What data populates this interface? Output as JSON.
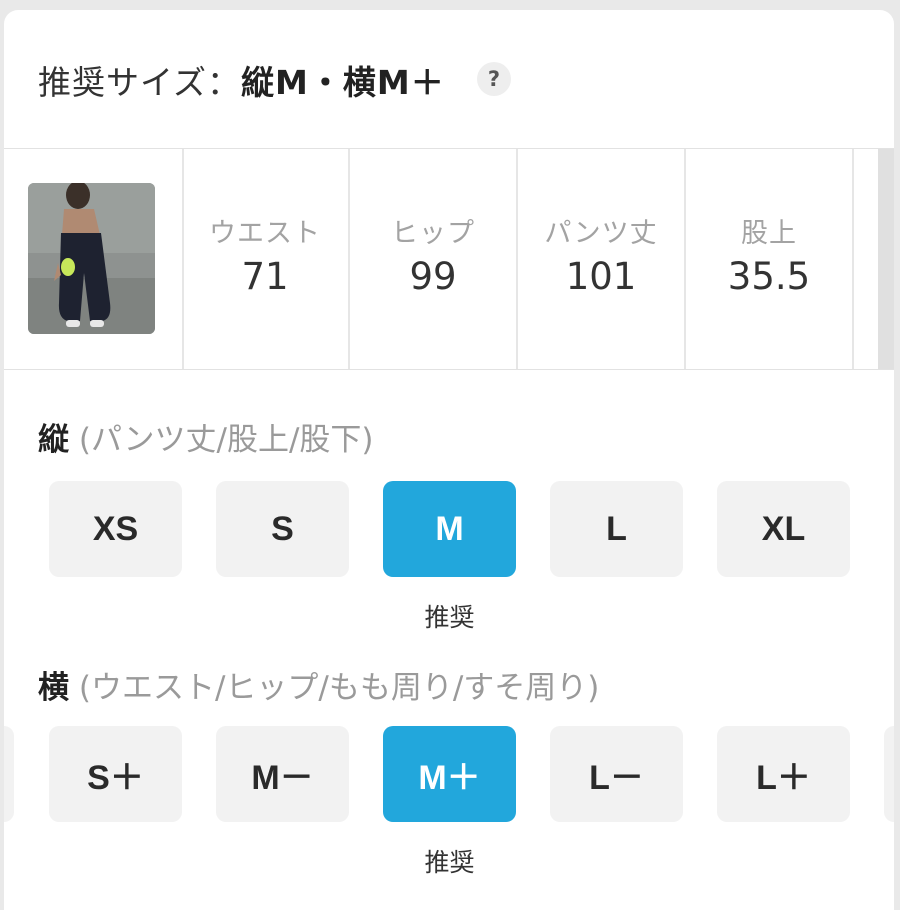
{
  "header": {
    "label": "推奨サイズ：",
    "value": "縦M・横M＋",
    "help_icon": "?"
  },
  "measurements": [
    {
      "label": "ウエスト",
      "value": "71"
    },
    {
      "label": "ヒップ",
      "value": "99"
    },
    {
      "label": "パンツ丈",
      "value": "101"
    },
    {
      "label": "股上",
      "value": "35.5"
    }
  ],
  "vertical": {
    "title": "縦",
    "subtitle": "(パンツ丈/股上/股下)",
    "sizes": [
      "XS",
      "S",
      "M",
      "L",
      "XL"
    ],
    "selected": "M",
    "recommended_label": "推奨"
  },
  "horizontal": {
    "title": "横",
    "subtitle": "(ウエスト/ヒップ/もも周り/すそ周り)",
    "sizes": [
      "S＋",
      "M－",
      "M＋",
      "L－",
      "L＋"
    ],
    "selected": "M＋",
    "recommended_label": "推奨"
  },
  "colors": {
    "accent": "#22a7dc",
    "button_bg": "#f2f2f2",
    "muted_text": "#a3a3a3"
  }
}
